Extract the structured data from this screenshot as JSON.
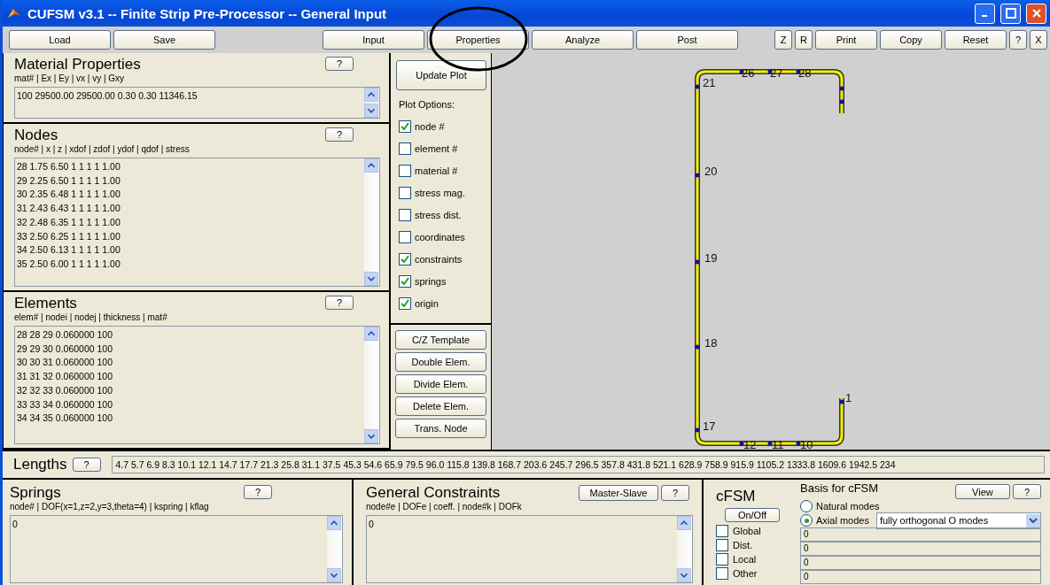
{
  "window": {
    "title": "CUFSM v3.1 -- Finite Strip Pre-Processor -- General Input"
  },
  "toolbar": [
    {
      "label": "Load",
      "kind": "wide"
    },
    {
      "label": "Save",
      "kind": "wide"
    },
    {
      "label": "Input",
      "kind": "wide"
    },
    {
      "label": "Properties",
      "kind": "wide"
    },
    {
      "label": "Analyze",
      "kind": "wide"
    },
    {
      "label": "Post",
      "kind": "wide"
    },
    {
      "label": "Z",
      "kind": "small"
    },
    {
      "label": "R",
      "kind": "small"
    },
    {
      "label": "Print",
      "kind": "mid"
    },
    {
      "label": "Copy",
      "kind": "mid"
    },
    {
      "label": "Reset",
      "kind": "mid"
    },
    {
      "label": "?",
      "kind": "small"
    },
    {
      "label": "X",
      "kind": "small"
    }
  ],
  "material": {
    "title": "Material Properties",
    "help": "?",
    "columns": "mat# | Ex | Ey | vx | vy | Gxy",
    "rows": [
      "100 29500.00 29500.00 0.30 0.30 11346.15"
    ]
  },
  "nodes": {
    "title": "Nodes",
    "help": "?",
    "columns": "node# | x | z | xdof | zdof | ydof | qdof | stress",
    "rows": [
      "28 1.75 6.50 1 1 1 1 1.00",
      "29 2.25 6.50 1 1 1 1 1.00",
      "30 2.35 6.48 1 1 1 1 1.00",
      "31 2.43 6.43 1 1 1 1 1.00",
      "32 2.48 6.35 1 1 1 1 1.00",
      "33 2.50 6.25 1 1 1 1 1.00",
      "34 2.50 6.13 1 1 1 1 1.00",
      "35 2.50 6.00 1 1 1 1 1.00"
    ]
  },
  "elements": {
    "title": "Elements",
    "help": "?",
    "columns": "elem# | nodei | nodej | thickness | mat#",
    "rows": [
      "28 28 29 0.060000 100",
      "29 29 30 0.060000 100",
      "30 30 31 0.060000 100",
      "31 31 32 0.060000 100",
      "32 32 33 0.060000 100",
      "33 33 34 0.060000 100",
      "34 34 35 0.060000 100"
    ]
  },
  "plot_options": {
    "update": "Update Plot",
    "heading": "Plot Options:",
    "options": [
      {
        "label": "node #",
        "checked": true
      },
      {
        "label": "element #",
        "checked": false
      },
      {
        "label": "material #",
        "checked": false
      },
      {
        "label": "stress mag.",
        "checked": false
      },
      {
        "label": "stress dist.",
        "checked": false
      },
      {
        "label": "coordinates",
        "checked": false
      },
      {
        "label": "constraints",
        "checked": true
      },
      {
        "label": "springs",
        "checked": true
      },
      {
        "label": "origin",
        "checked": true
      }
    ]
  },
  "tools": [
    "C/Z Template",
    "Double Elem.",
    "Divide Elem.",
    "Delete Elem.",
    "Trans. Node"
  ],
  "section_plot": {
    "node_labels": [
      "21",
      "26",
      "27",
      "28",
      "20",
      "19",
      "18",
      "17",
      "12",
      "11",
      "10",
      "1"
    ]
  },
  "lengths": {
    "label": "Lengths",
    "help": "?",
    "value": "4.7 5.7 6.9 8.3 10.1 12.1 14.7 17.7 21.3 25.8 31.1 37.5 45.3 54.6 65.9 79.5 96.0 115.8 139.8 168.7 203.6 245.7 296.5 357.8 431.8 521.1 628.9 758.9 915.9 1105.2 1333.8 1609.6 1942.5 234"
  },
  "springs": {
    "title": "Springs",
    "help": "?",
    "columns": "node# | DOF(x=1,z=2,y=3,theta=4) | kspring | kflag",
    "rows": [
      "0"
    ]
  },
  "constraints": {
    "title": "General Constraints",
    "master_slave": "Master-Slave",
    "help": "?",
    "columns": "node#e | DOFe | coeff. | node#k | DOFk",
    "rows": [
      "0"
    ]
  },
  "cfsm": {
    "title": "cFSM",
    "toggle": "On/Off",
    "basis_title": "Basis for cFSM",
    "view": "View",
    "help": "?",
    "modes": [
      {
        "label": "Natural modes",
        "selected": false
      },
      {
        "label": "Axial modes",
        "selected": true
      }
    ],
    "basis_select": "fully orthogonal O modes",
    "classes": [
      {
        "label": "Global",
        "checked": false,
        "value": "0"
      },
      {
        "label": "Dist.",
        "checked": false,
        "value": "0"
      },
      {
        "label": "Local",
        "checked": false,
        "value": "0"
      },
      {
        "label": "Other",
        "checked": false,
        "value": "0"
      }
    ]
  }
}
